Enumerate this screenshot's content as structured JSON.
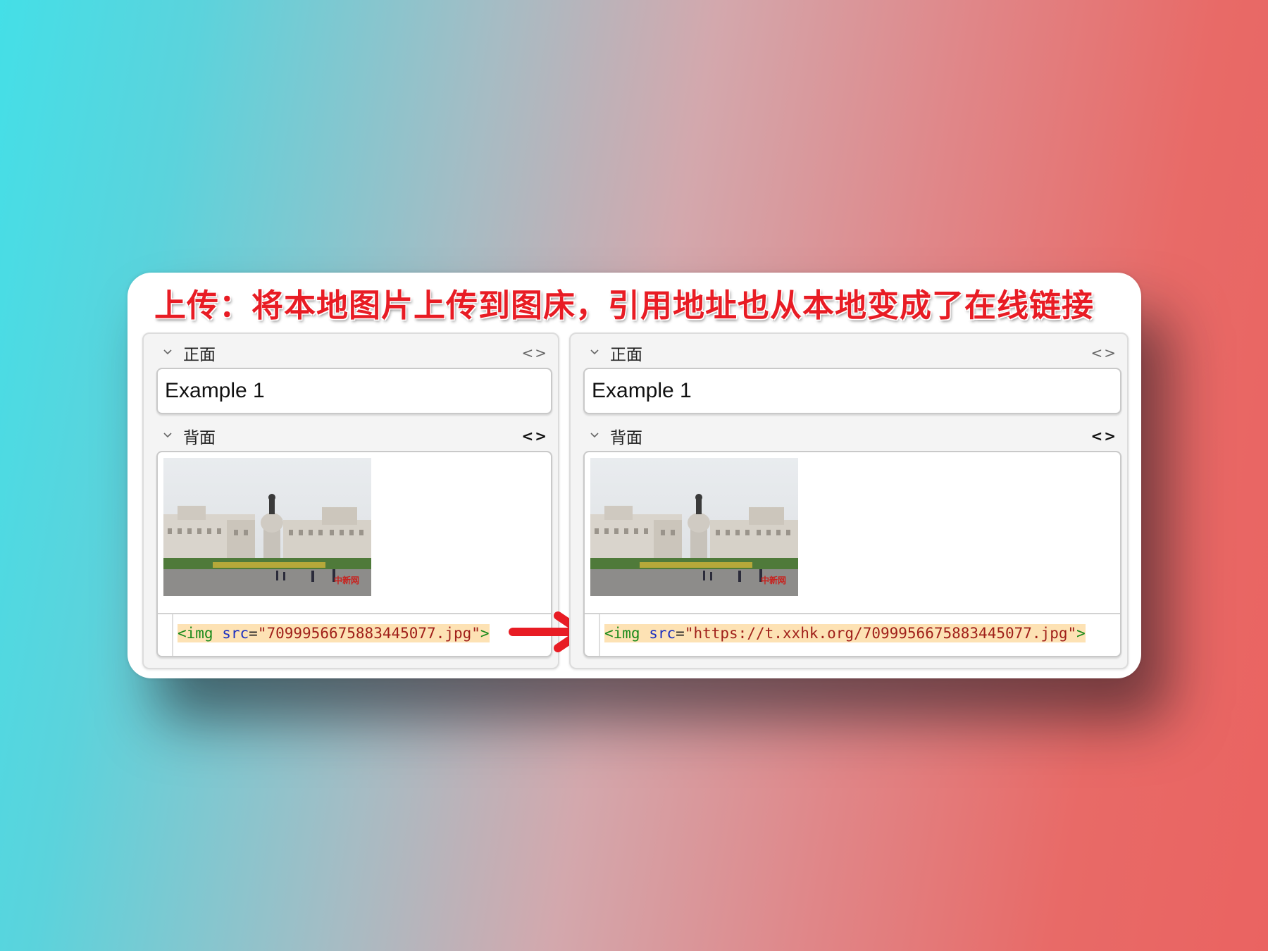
{
  "headline": "上传：将本地图片上传到图床，引用地址也从本地变成了在线链接",
  "colors": {
    "headline": "#e81c24",
    "arrow": "#e81c24",
    "code_highlight": "#fde2b4",
    "tag_token": "#1a8a1a",
    "attr_token": "#1c2fc0",
    "string_token": "#a0201a"
  },
  "editors": {
    "left": {
      "front": {
        "label": "正面",
        "value": "Example 1"
      },
      "back": {
        "label": "背面",
        "html": {
          "tag_open": "<img",
          "attr": "src",
          "eq": "=",
          "value": "\"7099956675883445077.jpg\"",
          "tag_close": ">"
        }
      }
    },
    "right": {
      "front": {
        "label": "正面",
        "value": "Example 1"
      },
      "back": {
        "label": "背面",
        "html": {
          "tag_open": "<img",
          "attr": "src",
          "eq": "=",
          "value": "\"https://t.xxhk.org/7099956675883445077.jpg\"",
          "tag_close": ">"
        }
      }
    }
  },
  "icons": {
    "collapse": "chevron-down-icon",
    "html_toggle": "code-brackets-icon",
    "transition": "arrow-right-icon"
  },
  "glyphs": {
    "html_toggle": "<>"
  }
}
